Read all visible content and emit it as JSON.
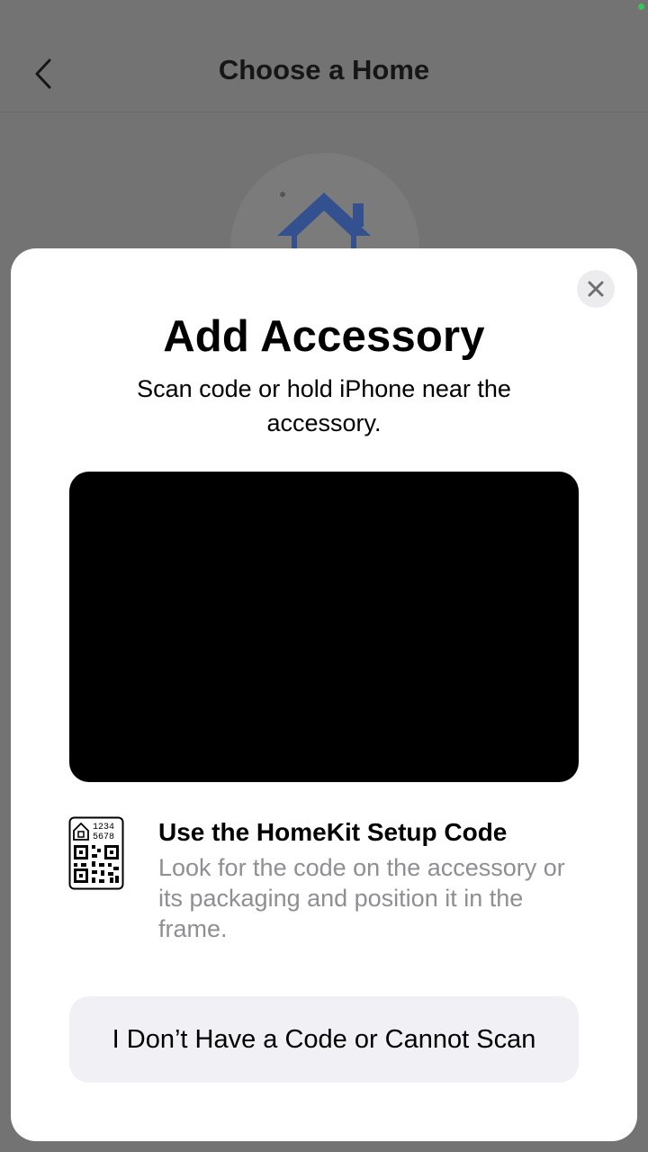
{
  "background": {
    "nav": {
      "title": "Choose a Home",
      "back_icon": "chevron-left-icon"
    },
    "illustration_icon": "house-icon"
  },
  "sheet": {
    "close_icon": "close-icon",
    "title": "Add Accessory",
    "subtitle": "Scan code or hold iPhone near the accessory.",
    "setup_code": {
      "icon": "homekit-code-icon",
      "code_line1": "1234",
      "code_line2": "5678",
      "title": "Use the HomeKit Setup Code",
      "body": "Look for the code on the accessory or its packaging and position it in the frame."
    },
    "no_code_button": "I Don’t Have a Code or Cannot Scan"
  },
  "colors": {
    "accent_green": "#35c759",
    "secondary_text": "#8e8e93",
    "button_bg": "#f0f0f5",
    "dim_overlay": "#737373"
  }
}
